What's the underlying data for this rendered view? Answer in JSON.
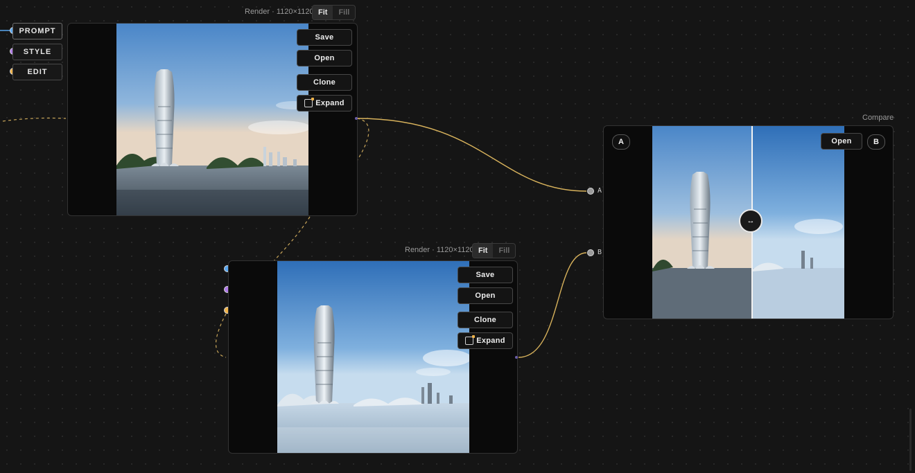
{
  "render_node_1": {
    "title": "Render · 1120×1120",
    "mode_fit": "Fit",
    "mode_fill": "Fill",
    "actions": {
      "save": "Save",
      "open": "Open",
      "clone": "Clone",
      "expand": "Expand"
    }
  },
  "render_node_2": {
    "title": "Render · 1120×1120",
    "mode_fit": "Fit",
    "mode_fill": "Fill",
    "actions": {
      "save": "Save",
      "open": "Open",
      "clone": "Clone",
      "expand": "Expand"
    }
  },
  "input_tags": {
    "prompt": "PROMPT",
    "style": "STYLE",
    "edit": "EDIT"
  },
  "compare_node": {
    "title": "Compare",
    "label_a": "A",
    "label_b": "B",
    "open": "Open",
    "input_a": "A",
    "input_b": "B",
    "divider_position": 0.52
  },
  "colors": {
    "wire_gold": "#d9b35c",
    "port_blue": "#5aa7f0",
    "port_purple": "#b07ae8",
    "port_gold": "#f0b34a",
    "background": "#151515"
  },
  "icons": {
    "expand": "expand-icon",
    "compare_handle": "left-right-arrow-icon"
  }
}
